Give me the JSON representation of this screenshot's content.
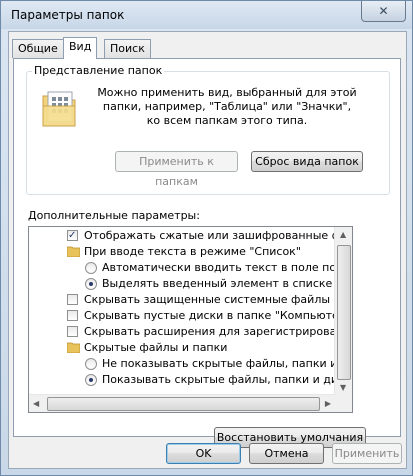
{
  "window": {
    "title": "Параметры папок",
    "close_glyph": "✕"
  },
  "tabs": [
    {
      "label": "Общие",
      "active": false
    },
    {
      "label": "Вид",
      "active": true
    },
    {
      "label": "Поиск",
      "active": false
    }
  ],
  "folder_views": {
    "legend": "Представление папок",
    "description": "Можно применить вид, выбранный для этой папки, например, \"Таблица\" или \"Значки\", ко всем папкам этого типа.",
    "apply_button": "Применить к папкам",
    "reset_button": "Сброс вида папок"
  },
  "advanced": {
    "label": "Дополнительные параметры:",
    "items": [
      {
        "kind": "checkbox",
        "checked": true,
        "text": "Отображать сжатые или зашифрованные файлы NTFS"
      },
      {
        "kind": "folder",
        "text": "При вводе текста в режиме \"Список\""
      },
      {
        "kind": "radio",
        "checked": false,
        "text": "Автоматически вводить текст в поле поиска"
      },
      {
        "kind": "radio",
        "checked": true,
        "text": "Выделять введенный элемент в списке"
      },
      {
        "kind": "checkbox",
        "checked": false,
        "text": "Скрывать защищенные системные файлы (рекомендуется)"
      },
      {
        "kind": "checkbox",
        "checked": false,
        "text": "Скрывать пустые диски в папке \"Компьютер\""
      },
      {
        "kind": "checkbox",
        "checked": false,
        "text": "Скрывать расширения для зарегистрированных типов файлов"
      },
      {
        "kind": "folder",
        "text": "Скрытые файлы и папки"
      },
      {
        "kind": "radio",
        "checked": false,
        "text": "Не показывать скрытые файлы, папки и диски"
      },
      {
        "kind": "radio",
        "checked": true,
        "text": "Показывать скрытые файлы, папки и диски"
      }
    ]
  },
  "restore_button": "Восстановить умолчания",
  "dialog_buttons": {
    "ok": "OK",
    "cancel": "Отмена",
    "apply": "Применить"
  },
  "colors": {
    "titlebar": "#c7d6e7",
    "panel": "#ffffff",
    "accent": "#3c7fb1"
  }
}
